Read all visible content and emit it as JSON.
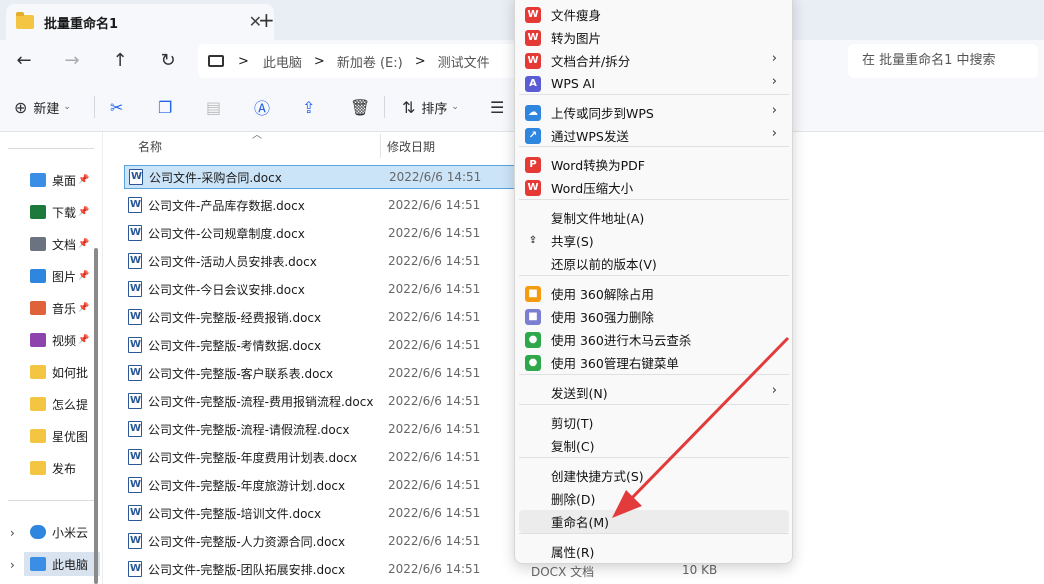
{
  "window": {
    "tab_title": "批量重命名1",
    "tab_close": "✕",
    "tab_new": "+"
  },
  "nav": {
    "back": "←",
    "forward": "→",
    "up": "↑",
    "refresh": "↻",
    "breadcrumb": [
      "此电脑",
      "新加卷 (E:)",
      "测试文件"
    ],
    "breadcrumb_sep": ">",
    "search_placeholder": "在 批量重命名1 中搜索"
  },
  "toolbar": {
    "new_label": "新建",
    "sort_label": "排序"
  },
  "sidebar": {
    "quick": [
      {
        "label": "桌面",
        "color": "#3a8ee6"
      },
      {
        "label": "下载",
        "color": "#1e7a3c"
      },
      {
        "label": "文档",
        "color": "#6b7280"
      },
      {
        "label": "图片",
        "color": "#2e86de"
      },
      {
        "label": "音乐",
        "color": "#e0623a"
      },
      {
        "label": "视频",
        "color": "#8e44ad"
      },
      {
        "label": "如何批",
        "color": "#f4c542"
      },
      {
        "label": "怎么提",
        "color": "#f4c542"
      },
      {
        "label": "星优图",
        "color": "#f4c542"
      },
      {
        "label": "发布",
        "color": "#f4c542"
      }
    ],
    "cloud": "小米云",
    "pc": "此电脑"
  },
  "filelist": {
    "col_name": "名称",
    "col_date": "修改日期",
    "files": [
      {
        "name": "公司文件-采购合同.docx",
        "date": "2022/6/6 14:51"
      },
      {
        "name": "公司文件-产品库存数据.docx",
        "date": "2022/6/6 14:51"
      },
      {
        "name": "公司文件-公司规章制度.docx",
        "date": "2022/6/6 14:51"
      },
      {
        "name": "公司文件-活动人员安排表.docx",
        "date": "2022/6/6 14:51"
      },
      {
        "name": "公司文件-今日会议安排.docx",
        "date": "2022/6/6 14:51"
      },
      {
        "name": "公司文件-完整版-经费报销.docx",
        "date": "2022/6/6 14:51"
      },
      {
        "name": "公司文件-完整版-考情数据.docx",
        "date": "2022/6/6 14:51"
      },
      {
        "name": "公司文件-完整版-客户联系表.docx",
        "date": "2022/6/6 14:51"
      },
      {
        "name": "公司文件-完整版-流程-费用报销流程.docx",
        "date": "2022/6/6 14:51"
      },
      {
        "name": "公司文件-完整版-流程-请假流程.docx",
        "date": "2022/6/6 14:51"
      },
      {
        "name": "公司文件-完整版-年度费用计划表.docx",
        "date": "2022/6/6 14:51"
      },
      {
        "name": "公司文件-完整版-年度旅游计划.docx",
        "date": "2022/6/6 14:51"
      },
      {
        "name": "公司文件-完整版-培训文件.docx",
        "date": "2022/6/6 14:51"
      },
      {
        "name": "公司文件-完整版-人力资源合同.docx",
        "date": "2022/6/6 14:51"
      },
      {
        "name": "公司文件-完整版-团队拓展安排.docx",
        "date": "2022/6/6 14:51"
      }
    ],
    "last_type": "DOCX 文档",
    "last_size": "10 KB"
  },
  "context_menu": {
    "items": [
      {
        "label": "文件瘦身",
        "icon": "W",
        "color": "#e53935",
        "arrow": false
      },
      {
        "label": "转为图片",
        "icon": "W",
        "color": "#e53935",
        "arrow": false
      },
      {
        "label": "文档合并/拆分",
        "icon": "W",
        "color": "#e53935",
        "arrow": true
      },
      {
        "label": "WPS AI",
        "icon": "A",
        "color": "#5b5bd6",
        "arrow": true
      },
      {
        "label": "上传或同步到WPS",
        "icon": "☁",
        "color": "#2e86de",
        "arrow": true
      },
      {
        "label": "通过WPS发送",
        "icon": "↗",
        "color": "#2e86de",
        "arrow": true
      },
      {
        "label": "Word转换为PDF",
        "icon": "P",
        "color": "#e53935",
        "arrow": false
      },
      {
        "label": "Word压缩大小",
        "icon": "W",
        "color": "#e53935",
        "arrow": false
      },
      {
        "label": "复制文件地址(A)",
        "icon": "",
        "color": "",
        "arrow": false
      },
      {
        "label": "共享(S)",
        "icon": "⇪",
        "color": "",
        "arrow": false
      },
      {
        "label": "还原以前的版本(V)",
        "icon": "",
        "color": "",
        "arrow": false
      },
      {
        "label": "使用 360解除占用",
        "icon": "■",
        "color": "#f39c12",
        "arrow": false
      },
      {
        "label": "使用 360强力删除",
        "icon": "■",
        "color": "#7b7fd1",
        "arrow": false
      },
      {
        "label": "使用 360进行木马云查杀",
        "icon": "●",
        "color": "#2ea84a",
        "arrow": false
      },
      {
        "label": "使用 360管理右键菜单",
        "icon": "●",
        "color": "#2ea84a",
        "arrow": false
      },
      {
        "label": "发送到(N)",
        "icon": "",
        "color": "",
        "arrow": true
      },
      {
        "label": "剪切(T)",
        "icon": "",
        "color": "",
        "arrow": false
      },
      {
        "label": "复制(C)",
        "icon": "",
        "color": "",
        "arrow": false
      },
      {
        "label": "创建快捷方式(S)",
        "icon": "",
        "color": "",
        "arrow": false
      },
      {
        "label": "删除(D)",
        "icon": "",
        "color": "",
        "arrow": false
      },
      {
        "label": "重命名(M)",
        "icon": "",
        "color": "",
        "arrow": false
      },
      {
        "label": "属性(R)",
        "icon": "",
        "color": "",
        "arrow": false
      }
    ],
    "highlighted": "重命名(M)"
  }
}
